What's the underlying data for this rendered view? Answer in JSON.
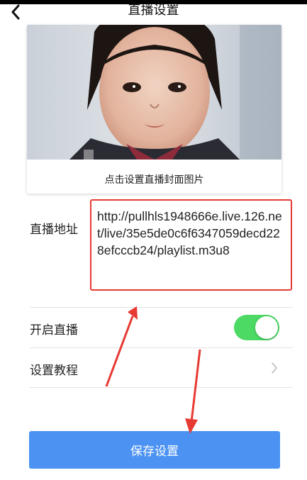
{
  "nav": {
    "title": "直播设置",
    "back_icon": "chevron-left-icon"
  },
  "cover": {
    "caption": "点击设置直播封面图片",
    "photo_description_icon": "child-portrait-image"
  },
  "stream_address": {
    "label": "直播地址",
    "value": "http://pullhls1948666e.live.126.net/live/35e5de0c6f6347059decd228efcccb24/playlist.m3u8"
  },
  "settings": {
    "live_toggle": {
      "label": "开启直播",
      "on": true
    },
    "tutorial": {
      "label": "设置教程",
      "icon": "chevron-right-icon"
    }
  },
  "save_button": {
    "label": "保存设置"
  },
  "colors": {
    "toggle_on": "#4cd964",
    "primary_button": "#4b92f2",
    "annotation_red": "#e63a32"
  }
}
